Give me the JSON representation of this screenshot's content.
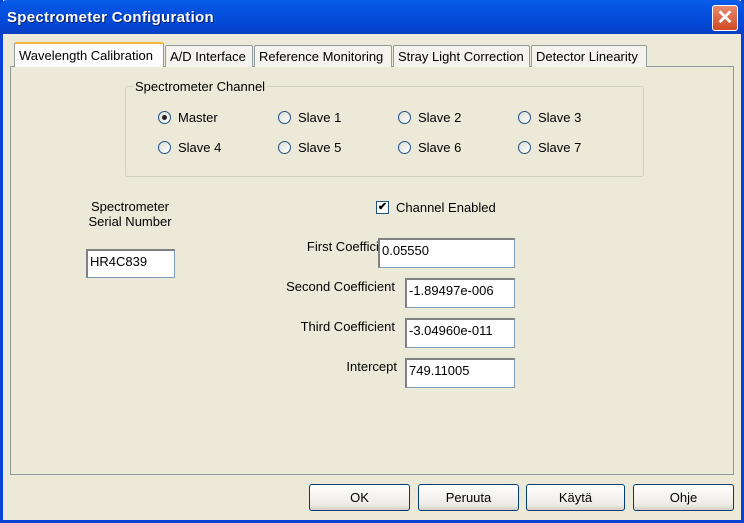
{
  "window": {
    "title": "Spectrometer Configuration",
    "close_icon": "close-icon"
  },
  "tabs": [
    {
      "label": "Wavelength Calibration",
      "active": true
    },
    {
      "label": "A/D Interface"
    },
    {
      "label": "Reference Monitoring"
    },
    {
      "label": "Stray Light Correction"
    },
    {
      "label": "Detector Linearity"
    }
  ],
  "channel_group": {
    "label": "Spectrometer Channel",
    "selected": "Master",
    "options": [
      "Master",
      "Slave 1",
      "Slave 2",
      "Slave 3",
      "Slave 4",
      "Slave 5",
      "Slave 6",
      "Slave 7"
    ]
  },
  "serial": {
    "label_line1": "Spectrometer",
    "label_line2": "Serial Number",
    "value": "HR4C839"
  },
  "channel_enabled": {
    "label": "Channel Enabled",
    "checked": true,
    "mark": "✔"
  },
  "coefficients": [
    {
      "label": "First Coefficient",
      "value": "0.05550"
    },
    {
      "label": "Second Coefficient",
      "value": "-1.89497e-006"
    },
    {
      "label": "Third Coefficient",
      "value": "-3.04960e-011"
    },
    {
      "label": "Intercept",
      "value": "749.11005"
    }
  ],
  "buttons": {
    "ok": "OK",
    "cancel": "Peruuta",
    "apply": "Käytä",
    "help": "Ohje"
  }
}
